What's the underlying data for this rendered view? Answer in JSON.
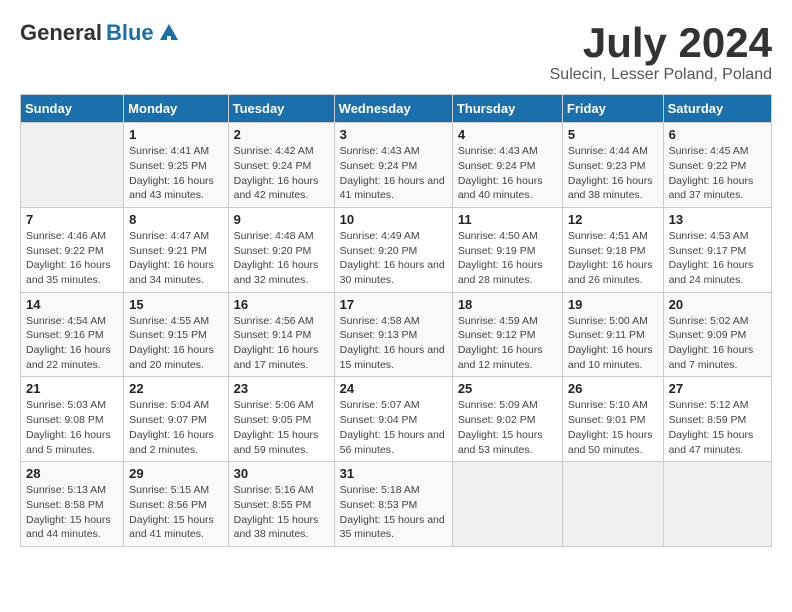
{
  "header": {
    "logo_general": "General",
    "logo_blue": "Blue",
    "month_title": "July 2024",
    "location": "Sulecin, Lesser Poland, Poland"
  },
  "days_of_week": [
    "Sunday",
    "Monday",
    "Tuesday",
    "Wednesday",
    "Thursday",
    "Friday",
    "Saturday"
  ],
  "weeks": [
    [
      {
        "day": "",
        "sunrise": "",
        "sunset": "",
        "daylight": ""
      },
      {
        "day": "1",
        "sunrise": "Sunrise: 4:41 AM",
        "sunset": "Sunset: 9:25 PM",
        "daylight": "Daylight: 16 hours and 43 minutes."
      },
      {
        "day": "2",
        "sunrise": "Sunrise: 4:42 AM",
        "sunset": "Sunset: 9:24 PM",
        "daylight": "Daylight: 16 hours and 42 minutes."
      },
      {
        "day": "3",
        "sunrise": "Sunrise: 4:43 AM",
        "sunset": "Sunset: 9:24 PM",
        "daylight": "Daylight: 16 hours and 41 minutes."
      },
      {
        "day": "4",
        "sunrise": "Sunrise: 4:43 AM",
        "sunset": "Sunset: 9:24 PM",
        "daylight": "Daylight: 16 hours and 40 minutes."
      },
      {
        "day": "5",
        "sunrise": "Sunrise: 4:44 AM",
        "sunset": "Sunset: 9:23 PM",
        "daylight": "Daylight: 16 hours and 38 minutes."
      },
      {
        "day": "6",
        "sunrise": "Sunrise: 4:45 AM",
        "sunset": "Sunset: 9:22 PM",
        "daylight": "Daylight: 16 hours and 37 minutes."
      }
    ],
    [
      {
        "day": "7",
        "sunrise": "Sunrise: 4:46 AM",
        "sunset": "Sunset: 9:22 PM",
        "daylight": "Daylight: 16 hours and 35 minutes."
      },
      {
        "day": "8",
        "sunrise": "Sunrise: 4:47 AM",
        "sunset": "Sunset: 9:21 PM",
        "daylight": "Daylight: 16 hours and 34 minutes."
      },
      {
        "day": "9",
        "sunrise": "Sunrise: 4:48 AM",
        "sunset": "Sunset: 9:20 PM",
        "daylight": "Daylight: 16 hours and 32 minutes."
      },
      {
        "day": "10",
        "sunrise": "Sunrise: 4:49 AM",
        "sunset": "Sunset: 9:20 PM",
        "daylight": "Daylight: 16 hours and 30 minutes."
      },
      {
        "day": "11",
        "sunrise": "Sunrise: 4:50 AM",
        "sunset": "Sunset: 9:19 PM",
        "daylight": "Daylight: 16 hours and 28 minutes."
      },
      {
        "day": "12",
        "sunrise": "Sunrise: 4:51 AM",
        "sunset": "Sunset: 9:18 PM",
        "daylight": "Daylight: 16 hours and 26 minutes."
      },
      {
        "day": "13",
        "sunrise": "Sunrise: 4:53 AM",
        "sunset": "Sunset: 9:17 PM",
        "daylight": "Daylight: 16 hours and 24 minutes."
      }
    ],
    [
      {
        "day": "14",
        "sunrise": "Sunrise: 4:54 AM",
        "sunset": "Sunset: 9:16 PM",
        "daylight": "Daylight: 16 hours and 22 minutes."
      },
      {
        "day": "15",
        "sunrise": "Sunrise: 4:55 AM",
        "sunset": "Sunset: 9:15 PM",
        "daylight": "Daylight: 16 hours and 20 minutes."
      },
      {
        "day": "16",
        "sunrise": "Sunrise: 4:56 AM",
        "sunset": "Sunset: 9:14 PM",
        "daylight": "Daylight: 16 hours and 17 minutes."
      },
      {
        "day": "17",
        "sunrise": "Sunrise: 4:58 AM",
        "sunset": "Sunset: 9:13 PM",
        "daylight": "Daylight: 16 hours and 15 minutes."
      },
      {
        "day": "18",
        "sunrise": "Sunrise: 4:59 AM",
        "sunset": "Sunset: 9:12 PM",
        "daylight": "Daylight: 16 hours and 12 minutes."
      },
      {
        "day": "19",
        "sunrise": "Sunrise: 5:00 AM",
        "sunset": "Sunset: 9:11 PM",
        "daylight": "Daylight: 16 hours and 10 minutes."
      },
      {
        "day": "20",
        "sunrise": "Sunrise: 5:02 AM",
        "sunset": "Sunset: 9:09 PM",
        "daylight": "Daylight: 16 hours and 7 minutes."
      }
    ],
    [
      {
        "day": "21",
        "sunrise": "Sunrise: 5:03 AM",
        "sunset": "Sunset: 9:08 PM",
        "daylight": "Daylight: 16 hours and 5 minutes."
      },
      {
        "day": "22",
        "sunrise": "Sunrise: 5:04 AM",
        "sunset": "Sunset: 9:07 PM",
        "daylight": "Daylight: 16 hours and 2 minutes."
      },
      {
        "day": "23",
        "sunrise": "Sunrise: 5:06 AM",
        "sunset": "Sunset: 9:05 PM",
        "daylight": "Daylight: 15 hours and 59 minutes."
      },
      {
        "day": "24",
        "sunrise": "Sunrise: 5:07 AM",
        "sunset": "Sunset: 9:04 PM",
        "daylight": "Daylight: 15 hours and 56 minutes."
      },
      {
        "day": "25",
        "sunrise": "Sunrise: 5:09 AM",
        "sunset": "Sunset: 9:02 PM",
        "daylight": "Daylight: 15 hours and 53 minutes."
      },
      {
        "day": "26",
        "sunrise": "Sunrise: 5:10 AM",
        "sunset": "Sunset: 9:01 PM",
        "daylight": "Daylight: 15 hours and 50 minutes."
      },
      {
        "day": "27",
        "sunrise": "Sunrise: 5:12 AM",
        "sunset": "Sunset: 8:59 PM",
        "daylight": "Daylight: 15 hours and 47 minutes."
      }
    ],
    [
      {
        "day": "28",
        "sunrise": "Sunrise: 5:13 AM",
        "sunset": "Sunset: 8:58 PM",
        "daylight": "Daylight: 15 hours and 44 minutes."
      },
      {
        "day": "29",
        "sunrise": "Sunrise: 5:15 AM",
        "sunset": "Sunset: 8:56 PM",
        "daylight": "Daylight: 15 hours and 41 minutes."
      },
      {
        "day": "30",
        "sunrise": "Sunrise: 5:16 AM",
        "sunset": "Sunset: 8:55 PM",
        "daylight": "Daylight: 15 hours and 38 minutes."
      },
      {
        "day": "31",
        "sunrise": "Sunrise: 5:18 AM",
        "sunset": "Sunset: 8:53 PM",
        "daylight": "Daylight: 15 hours and 35 minutes."
      },
      {
        "day": "",
        "sunrise": "",
        "sunset": "",
        "daylight": ""
      },
      {
        "day": "",
        "sunrise": "",
        "sunset": "",
        "daylight": ""
      },
      {
        "day": "",
        "sunrise": "",
        "sunset": "",
        "daylight": ""
      }
    ]
  ]
}
